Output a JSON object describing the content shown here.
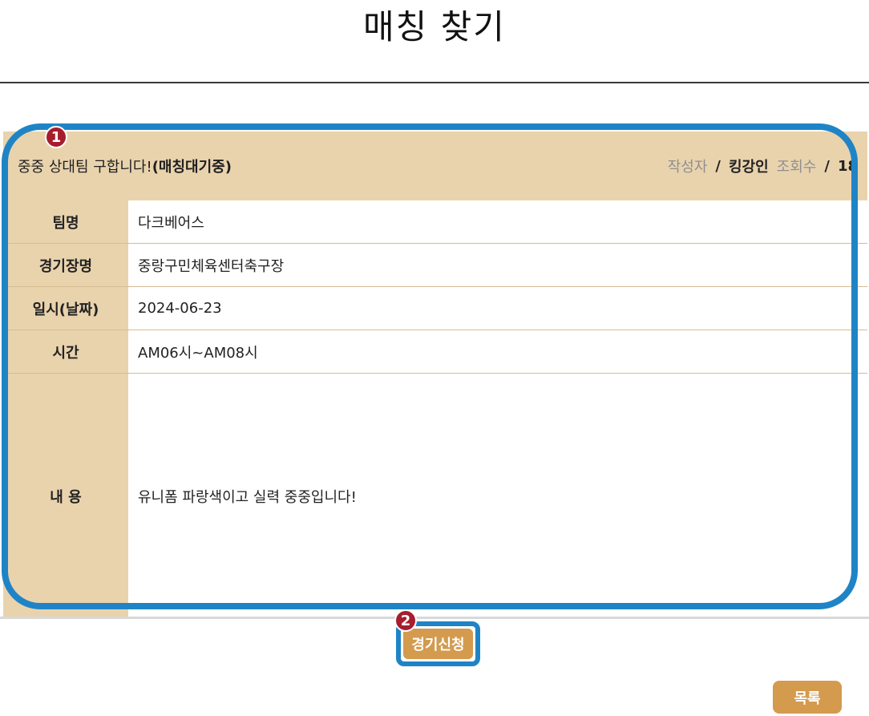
{
  "page": {
    "title": "매칭 찾기"
  },
  "post": {
    "title_prefix": "중중 상대팀 구합니다!",
    "title_status": "(매칭대기중)",
    "author_label": "작성자",
    "author_name": "킹강인",
    "views_label": "조회수",
    "views_count": "18",
    "separator": "/"
  },
  "details": {
    "team_label": "팀명",
    "team_value": "다크베어스",
    "venue_label": "경기장명",
    "venue_value": "중랑구민체육센터축구장",
    "date_label": "일시(날짜)",
    "date_value": "2024-06-23",
    "time_label": "시간",
    "time_value": "AM06시~AM08시",
    "content_label": "내 용",
    "content_value": "유니폼 파랑색이고 실력 중중입니다!"
  },
  "annotations": {
    "badge_1": "1",
    "badge_2": "2"
  },
  "buttons": {
    "apply": "경기신청",
    "list": "목록"
  },
  "colors": {
    "beige": "#e9d3ad",
    "gold_button": "#d49a4e",
    "annotation_blue": "#1f84c6",
    "badge_red": "#a61d2e"
  }
}
